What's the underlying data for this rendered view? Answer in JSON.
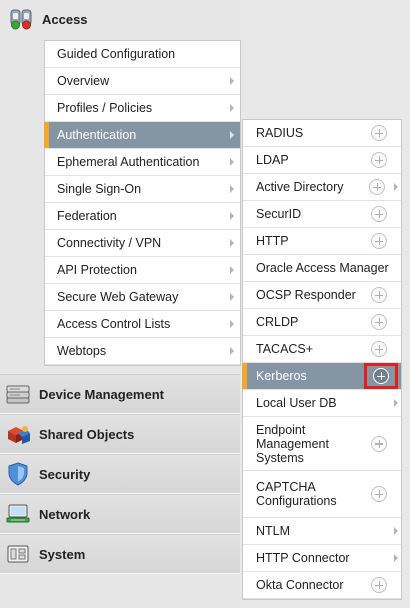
{
  "nav": {
    "access_label": "Access",
    "sections": [
      {
        "label": "Device Management",
        "icon": "device-management-icon"
      },
      {
        "label": "Shared Objects",
        "icon": "shared-objects-icon"
      },
      {
        "label": "Security",
        "icon": "security-shield-icon"
      },
      {
        "label": "Network",
        "icon": "network-icon"
      },
      {
        "label": "System",
        "icon": "system-icon"
      }
    ]
  },
  "access_menu": {
    "items": [
      {
        "label": "Guided Configuration",
        "has_chevron": false
      },
      {
        "label": "Overview",
        "has_chevron": true
      },
      {
        "label": "Profiles / Policies",
        "has_chevron": true
      },
      {
        "label": "Authentication",
        "has_chevron": true,
        "active": true
      },
      {
        "label": "Ephemeral Authentication",
        "has_chevron": true
      },
      {
        "label": "Single Sign-On",
        "has_chevron": true
      },
      {
        "label": "Federation",
        "has_chevron": true
      },
      {
        "label": "Connectivity / VPN",
        "has_chevron": true
      },
      {
        "label": "API Protection",
        "has_chevron": true
      },
      {
        "label": "Secure Web Gateway",
        "has_chevron": true
      },
      {
        "label": "Access Control Lists",
        "has_chevron": true
      },
      {
        "label": "Webtops",
        "has_chevron": true
      }
    ]
  },
  "auth_menu": {
    "items": [
      {
        "label": "RADIUS"
      },
      {
        "label": "LDAP"
      },
      {
        "label": "Active Directory"
      },
      {
        "label": "SecurID"
      },
      {
        "label": "HTTP"
      },
      {
        "label": "Oracle Access Manager"
      },
      {
        "label": "OCSP Responder"
      },
      {
        "label": "CRLDP"
      },
      {
        "label": "TACACS+"
      },
      {
        "label": "Kerberos"
      },
      {
        "label": "Local User DB"
      },
      {
        "label": "Endpoint Management Systems"
      },
      {
        "label": "CAPTCHA Configurations"
      },
      {
        "label": "NTLM"
      },
      {
        "label": "HTTP Connector"
      },
      {
        "label": "Okta Connector"
      }
    ]
  },
  "colors": {
    "active_bg": "#8595a3",
    "active_marker": "#f0a92c",
    "highlight": "#e0201e"
  }
}
